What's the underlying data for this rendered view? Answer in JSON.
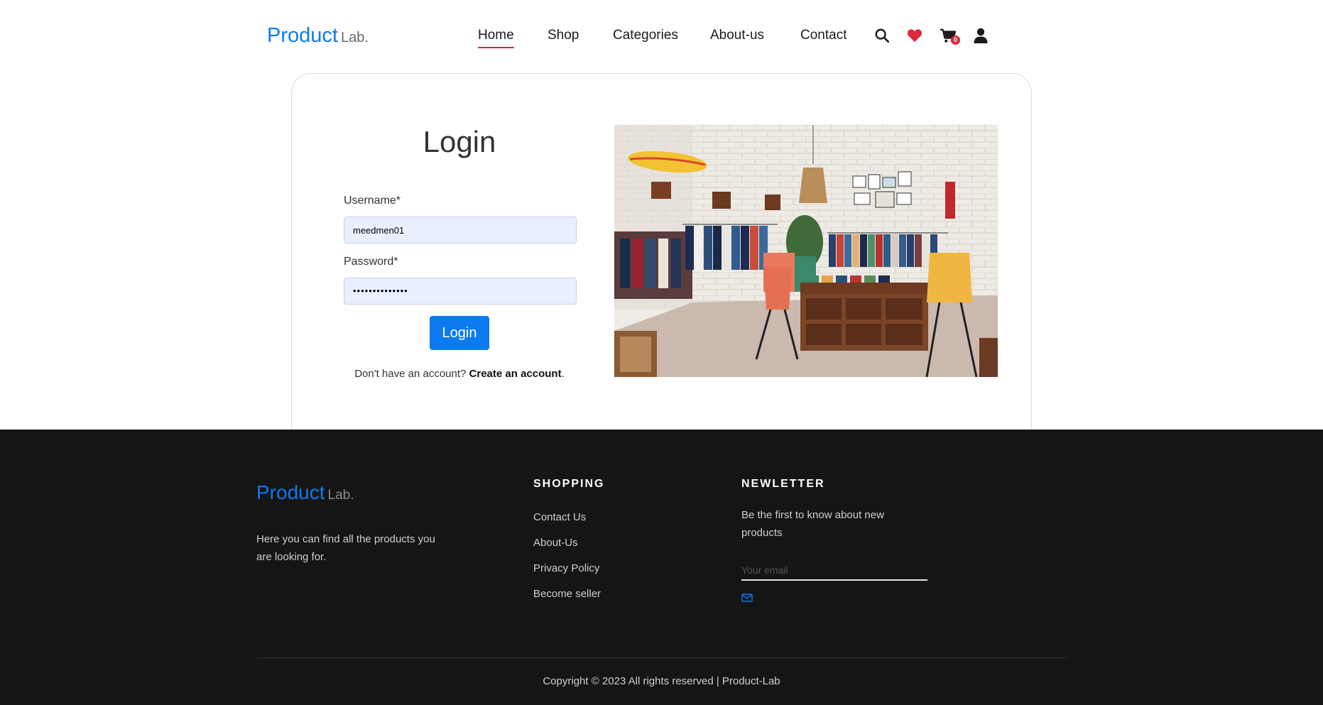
{
  "brand": {
    "name": "Product",
    "suffix": "Lab."
  },
  "nav": {
    "items": [
      {
        "label": "Home",
        "active": true
      },
      {
        "label": "Shop"
      },
      {
        "label": "Categories"
      },
      {
        "label": "About-us"
      },
      {
        "label": "Contact"
      }
    ],
    "icons": [
      "search-icon",
      "heart-icon",
      "cart-icon",
      "user-icon"
    ],
    "cart_count": "0"
  },
  "login": {
    "title": "Login",
    "username_label": "Username*",
    "username_value": "meedmen01",
    "password_label": "Password*",
    "password_value": "••••••••••••••",
    "button_label": "Login",
    "signup_prompt": "Don't have an account?",
    "signup_link": "Create an account",
    "signup_end": "."
  },
  "footer": {
    "description": "Here you can find all the products you are looking for.",
    "shopping": {
      "heading": "SHOPPING",
      "links": [
        "Contact Us",
        "About-Us",
        "Privacy Policy",
        "Become seller"
      ]
    },
    "newsletter": {
      "heading": "NEWLETTER",
      "text": "Be the first to know about new products",
      "placeholder": "Your email"
    },
    "copyright": "Copyright © 2023 All rights reserved | Product-Lab"
  },
  "colors": {
    "accent": "#0d7bf0",
    "active_underline": "#e0273a",
    "footer_bg": "#151515"
  }
}
